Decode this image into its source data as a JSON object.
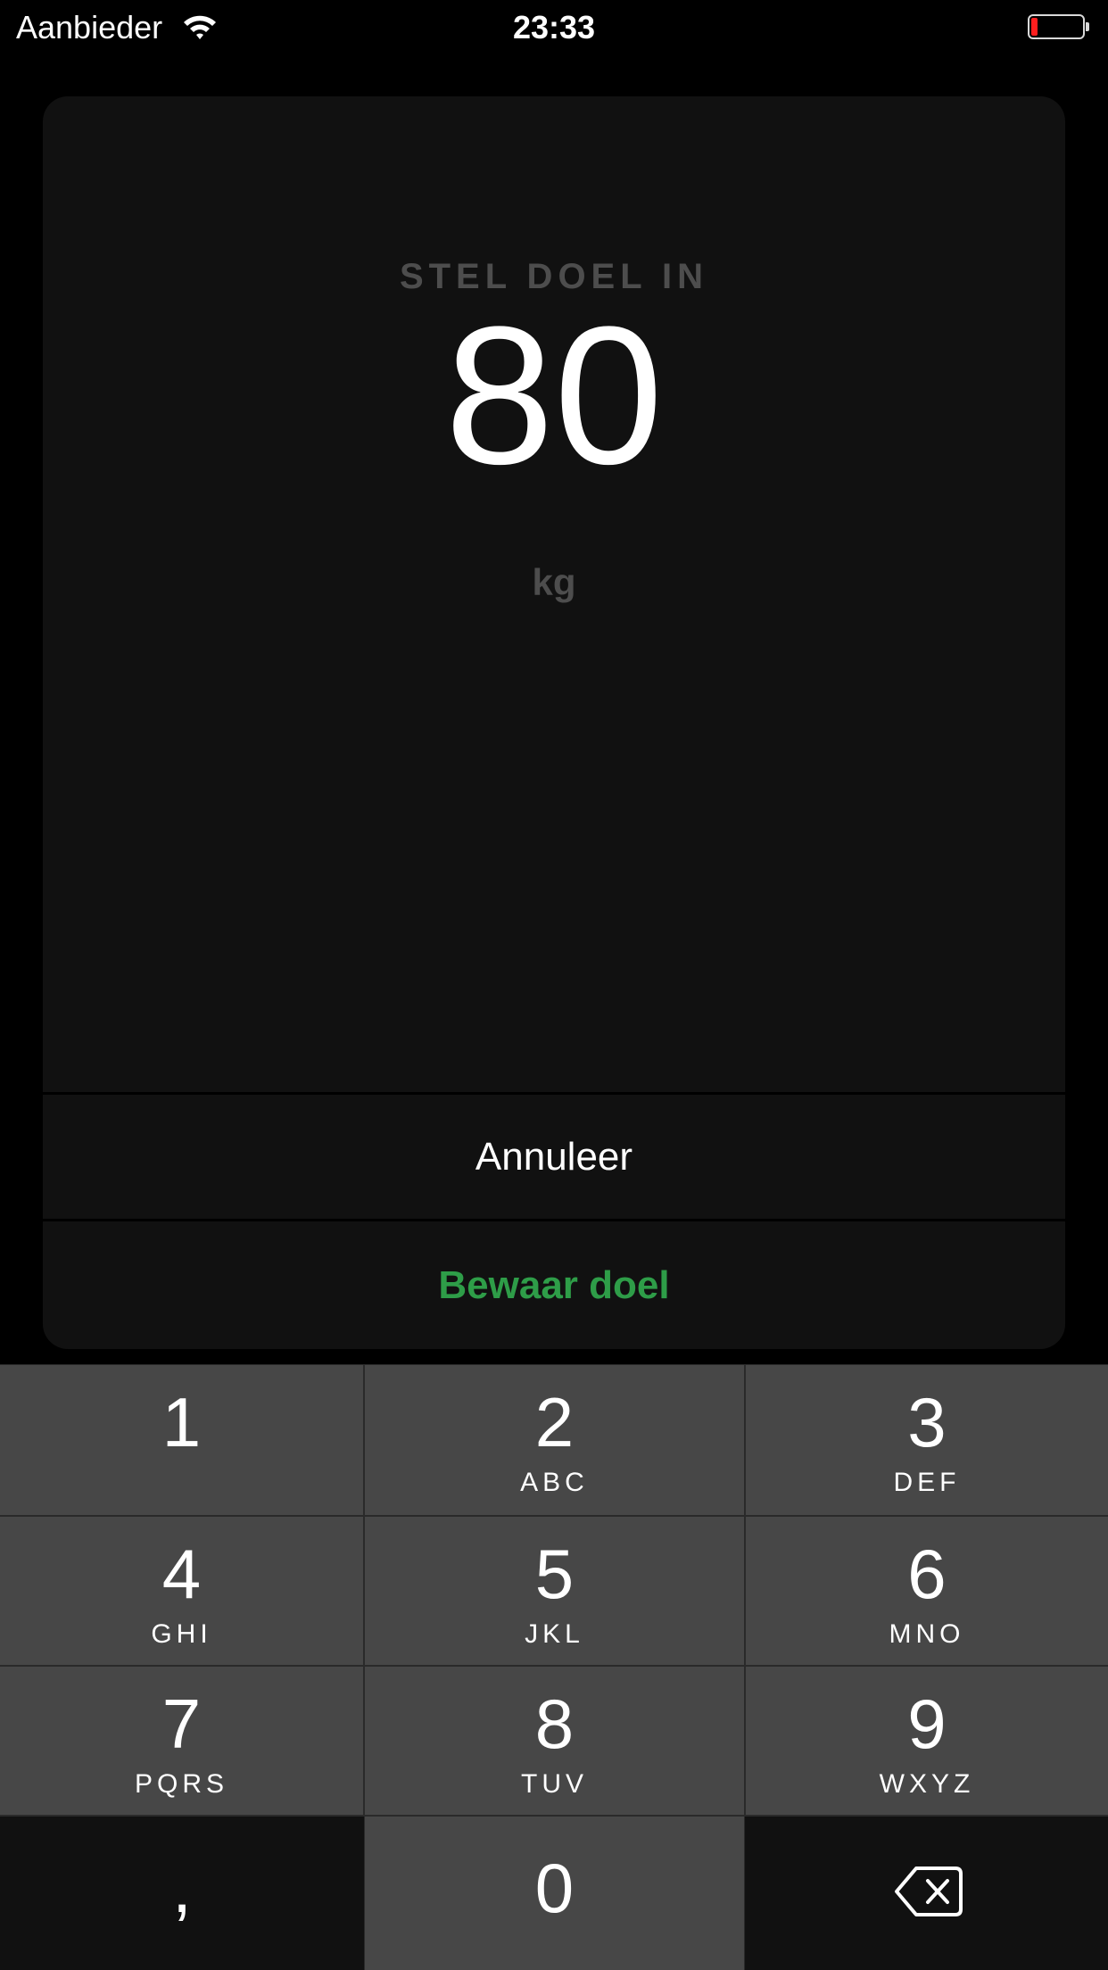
{
  "status_bar": {
    "carrier": "Aanbieder",
    "time": "23:33",
    "wifi_icon": "wifi-icon",
    "battery_icon": "battery-low-icon",
    "battery_level": 0.12
  },
  "card": {
    "title": "STEL DOEL IN",
    "value": "80",
    "unit": "kg",
    "cancel_label": "Annuleer",
    "save_label": "Bewaar doel"
  },
  "colors": {
    "background": "#000000",
    "card": "#111111",
    "muted_text": "#4d4d4d",
    "accent_green": "#2e9d48",
    "key": "#474747",
    "battery_red": "#ff1e1e"
  },
  "keypad": {
    "keys": [
      {
        "number": "1",
        "letters": ""
      },
      {
        "number": "2",
        "letters": "ABC"
      },
      {
        "number": "3",
        "letters": "DEF"
      },
      {
        "number": "4",
        "letters": "GHI"
      },
      {
        "number": "5",
        "letters": "JKL"
      },
      {
        "number": "6",
        "letters": "MNO"
      },
      {
        "number": "7",
        "letters": "PQRS"
      },
      {
        "number": "8",
        "letters": "TUV"
      },
      {
        "number": "9",
        "letters": "WXYZ"
      }
    ],
    "comma": ",",
    "zero": "0",
    "backspace_icon": "backspace-icon"
  }
}
